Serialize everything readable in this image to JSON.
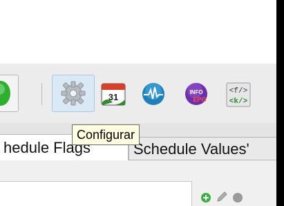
{
  "toolbar": {
    "buttons": [
      {
        "name": "prev-action-icon",
        "color": "#2fae2f"
      },
      {
        "name": "gear-icon",
        "color": "#9aa0a6"
      },
      {
        "name": "calendar-icon",
        "label": "31",
        "color": "#2e8b2e"
      },
      {
        "name": "waveform-icon",
        "color": "#1f7fb8"
      },
      {
        "name": "info-icon",
        "label": "INFO",
        "sublabel": "EPG",
        "color": "#7a2fb0"
      },
      {
        "name": "code-tags-icon",
        "label1": "<f/>",
        "label2": "<k/>",
        "color": "#2f8a2f"
      }
    ]
  },
  "tooltip": {
    "text": "Configurar"
  },
  "tabs": [
    {
      "label": "hedule Flags"
    },
    {
      "label": "Schedule Values'"
    }
  ],
  "mini_icons": [
    {
      "name": "add-icon",
      "color": "#3cb043"
    },
    {
      "name": "edit-icon",
      "color": "#9a9a9a"
    },
    {
      "name": "remove-icon",
      "color": "#8a8a8a"
    }
  ]
}
